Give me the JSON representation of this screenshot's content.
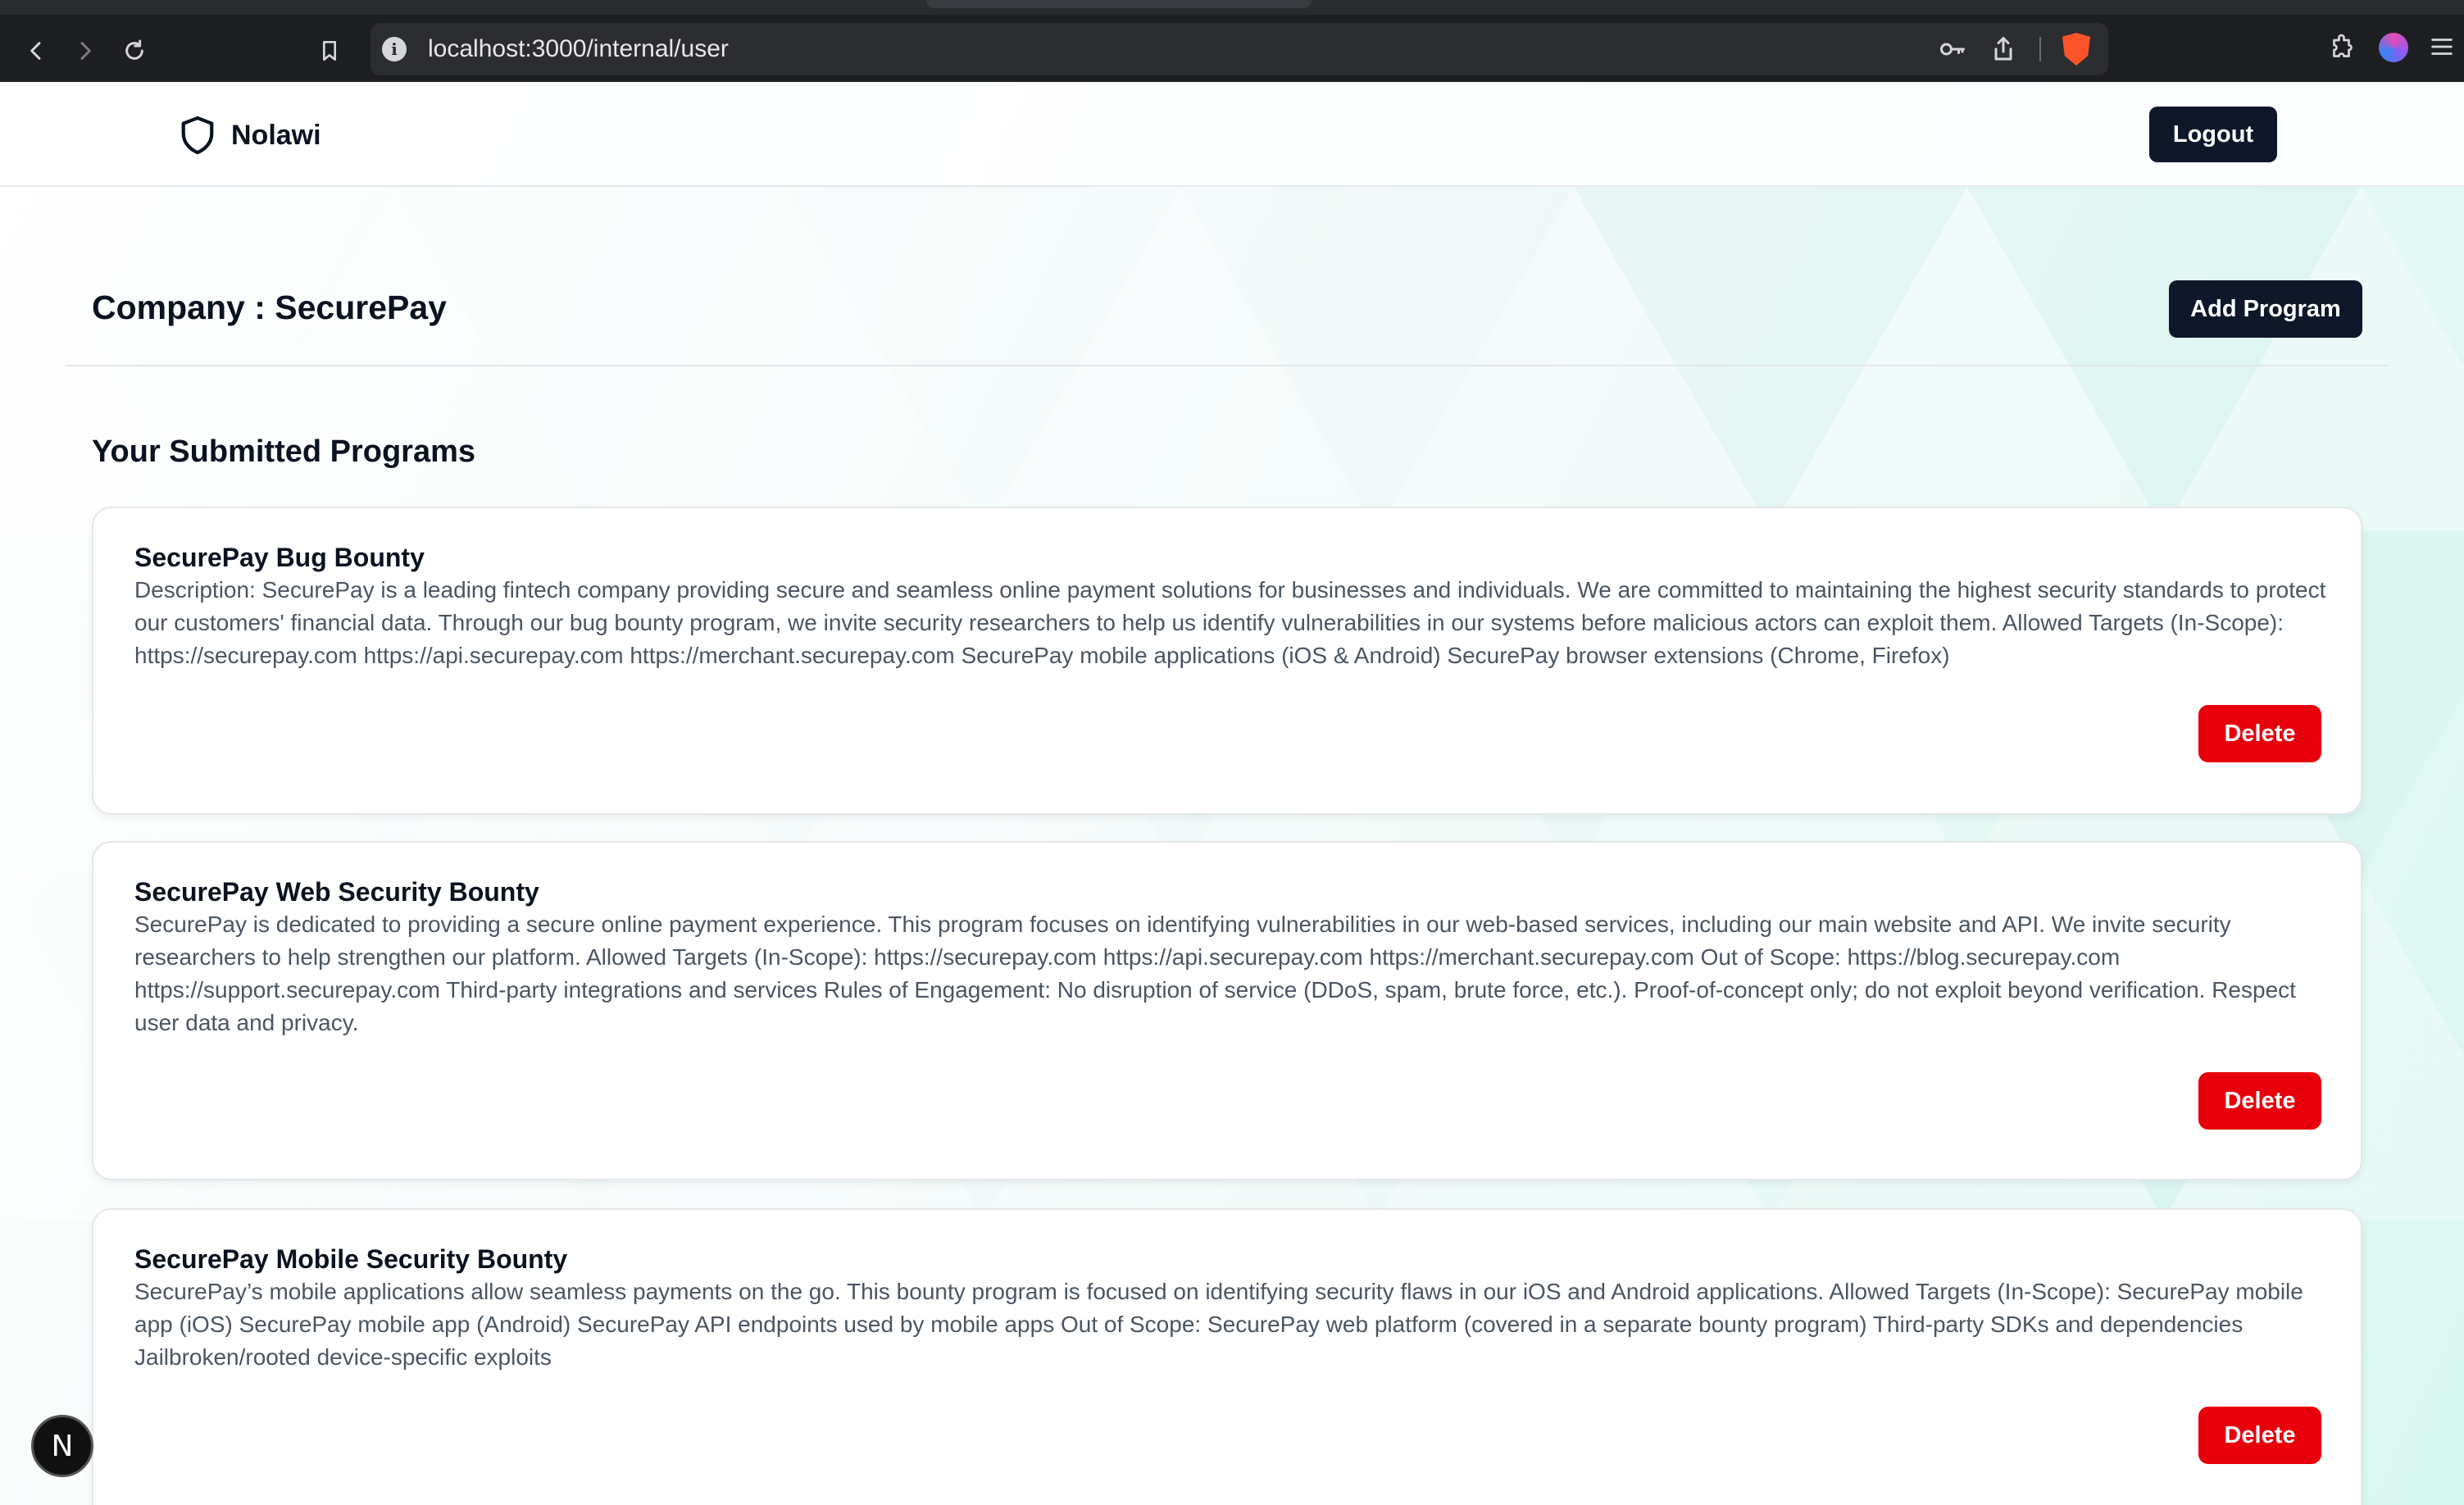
{
  "browser": {
    "url": "localhost:3000/internal/user",
    "icons": [
      "back-icon",
      "forward-icon",
      "reload-icon",
      "bookmark-icon",
      "site-info-icon",
      "password-key-icon",
      "share-icon",
      "brave-shield-icon",
      "extensions-icon",
      "profile-icon",
      "menu-icon"
    ]
  },
  "header": {
    "brand_name": "Nolawi",
    "brand_icon": "shield-icon",
    "logout_label": "Logout"
  },
  "company": {
    "title": "Company : SecurePay",
    "add_program_label": "Add Program"
  },
  "programs_section": {
    "title": "Your Submitted Programs",
    "programs": [
      {
        "title": "SecurePay Bug Bounty",
        "description": "Description: SecurePay is a leading fintech company providing secure and seamless online payment solutions for businesses and individuals. We are committed to maintaining the highest security standards to protect our customers' financial data. Through our bug bounty program, we invite security researchers to help us identify vulnerabilities in our systems before malicious actors can exploit them. Allowed Targets (In-Scope): https://securepay.com https://api.securepay.com https://merchant.securepay.com SecurePay mobile applications (iOS & Android) SecurePay browser extensions (Chrome, Firefox)",
        "delete_label": "Delete"
      },
      {
        "title": "SecurePay Web Security Bounty",
        "description": "SecurePay is dedicated to providing a secure online payment experience. This program focuses on identifying vulnerabilities in our web-based services, including our main website and API. We invite security researchers to help strengthen our platform. Allowed Targets (In-Scope): https://securepay.com https://api.securepay.com https://merchant.securepay.com Out of Scope: https://blog.securepay.com https://support.securepay.com Third-party integrations and services Rules of Engagement: No disruption of service (DDoS, spam, brute force, etc.). Proof-of-concept only; do not exploit beyond verification. Respect user data and privacy.",
        "delete_label": "Delete"
      },
      {
        "title": "SecurePay Mobile Security Bounty",
        "description": "SecurePay’s mobile applications allow seamless payments on the go. This bounty program is focused on identifying security flaws in our iOS and Android applications. Allowed Targets (In-Scope): SecurePay mobile app (iOS) SecurePay mobile app (Android) SecurePay API endpoints used by mobile apps Out of Scope: SecurePay web platform (covered in a separate bounty program) Third-party SDKs and dependencies Jailbroken/rooted device-specific exploits",
        "delete_label": "Delete"
      }
    ]
  },
  "dev_badge": {
    "label": "N"
  },
  "colors": {
    "primary_dark": "#0f172a",
    "danger": "#e7000b",
    "accent_bg": "#d8f7f1"
  }
}
